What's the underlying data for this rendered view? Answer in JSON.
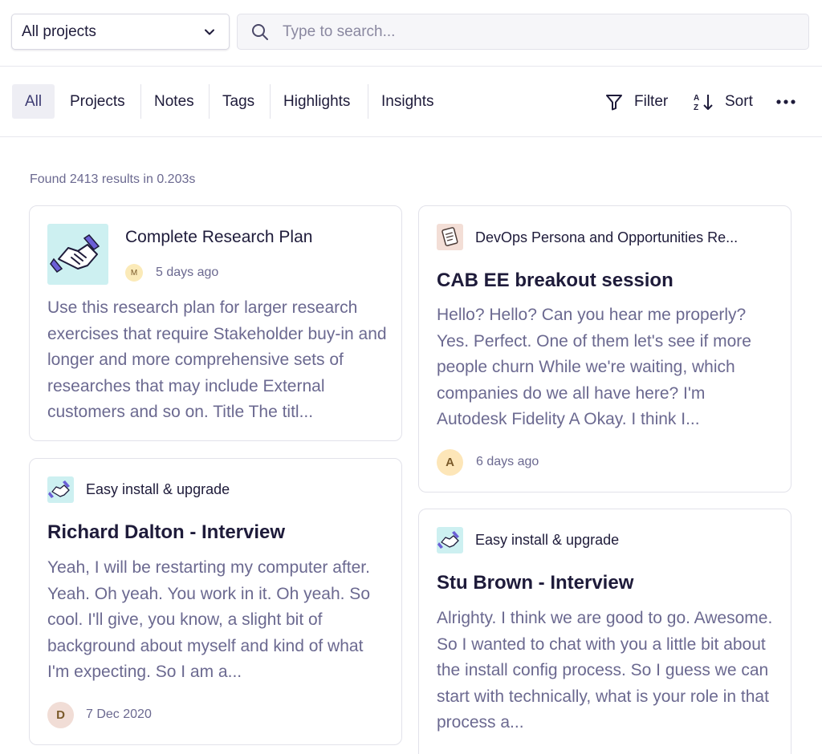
{
  "toolbar": {
    "project_select": "All projects",
    "search_placeholder": "Type to search..."
  },
  "tabs": [
    "All",
    "Projects",
    "Notes",
    "Tags",
    "Highlights",
    "Insights"
  ],
  "actions": {
    "filter": "Filter",
    "sort": "Sort"
  },
  "results": {
    "summary": "Found 2413 results in 0.203s"
  },
  "cards": [
    {
      "title": "Complete Research Plan",
      "avatar": "M",
      "date": "5 days ago",
      "body": "Use this research plan for larger research exercises that require Stakeholder buy-in and longer and more comprehensive sets of researches that may include External customers and so on. Title The titl..."
    },
    {
      "project": "DevOps Persona and Opportunities Re...",
      "heading": "CAB EE breakout session",
      "body": "Hello? Hello? Can you hear me properly? Yes. Perfect. One of them let's see if more people churn While we're waiting, which companies do we all have here? I'm Autodesk Fidelity A Okay. I think I...",
      "avatar": "A",
      "date": "6 days ago"
    },
    {
      "project": "Easy install & upgrade",
      "heading": "Richard Dalton - Interview",
      "body": "Yeah, I will be restarting my computer after. Yeah. Oh yeah. You work in it. Oh yeah. So cool. I'll give, you know, a slight bit of background about myself and kind of what I'm expecting. So I am a...",
      "avatar": "D",
      "date": "7 Dec 2020"
    },
    {
      "project": "Easy install & upgrade",
      "heading": "Stu Brown - Interview",
      "body": "Alrighty. I think we are good to go. Awesome. So I wanted to chat with you a little bit about the install config process. So I guess we can start with technically, what is your role in that process a..."
    }
  ],
  "colors": {
    "accent": "#3d3b72",
    "text": "#1e1b3a",
    "muted": "#6b6990",
    "thumb_teal": "#cdf0f1",
    "thumb_peach": "#f3ded6",
    "avatar_m": "#fbeab8",
    "avatar_a": "#fde6b8",
    "avatar_d": "#f1ddd6"
  }
}
